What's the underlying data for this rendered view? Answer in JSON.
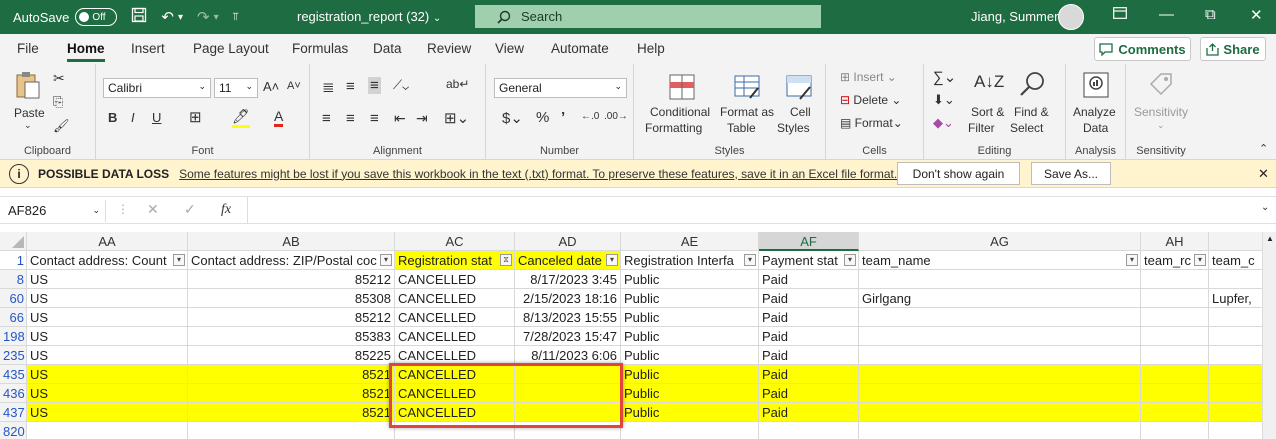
{
  "titlebar": {
    "autosave_label": "AutoSave",
    "autosave_state": "Off",
    "filename": "registration_report (32)",
    "search_placeholder": "Search",
    "user_name": "Jiang, Summer"
  },
  "ribbon_tabs": [
    "File",
    "Home",
    "Insert",
    "Page Layout",
    "Formulas",
    "Data",
    "Review",
    "View",
    "Automate",
    "Help"
  ],
  "active_tab": "Home",
  "header_buttons": {
    "comments": "Comments",
    "share": "Share"
  },
  "ribbon": {
    "clipboard": {
      "label": "Clipboard",
      "paste": "Paste"
    },
    "font": {
      "label": "Font",
      "font_name": "Calibri",
      "font_size": "11"
    },
    "alignment": {
      "label": "Alignment"
    },
    "number": {
      "label": "Number",
      "format": "General"
    },
    "styles": {
      "label": "Styles",
      "cond1": "Conditional",
      "cond2": "Formatting",
      "fmt1": "Format as",
      "fmt2": "Table",
      "cell1": "Cell",
      "cell2": "Styles"
    },
    "cells": {
      "label": "Cells",
      "insert": "Insert",
      "delete": "Delete",
      "format": "Format"
    },
    "editing": {
      "label": "Editing",
      "sort1": "Sort &",
      "sort2": "Filter",
      "find1": "Find &",
      "find2": "Select"
    },
    "analysis": {
      "label": "Analysis",
      "analyze1": "Analyze",
      "analyze2": "Data"
    },
    "sensitivity": {
      "label": "Sensitivity",
      "button": "Sensitivity"
    }
  },
  "message_bar": {
    "title": "POSSIBLE DATA LOSS",
    "text": "Some features might be lost if you save this workbook in the text (.txt) format. To preserve these features, save it in an Excel file format.",
    "btn_dont_show": "Don't show again",
    "btn_save_as": "Save As..."
  },
  "formula_bar": {
    "name_box": "AF826",
    "fx": "fx"
  },
  "column_headers": [
    "AA",
    "AB",
    "AC",
    "AD",
    "AE",
    "AF",
    "AG",
    "AH"
  ],
  "header_row": {
    "row_num": "1",
    "cells": [
      "Contact address: Count",
      "Contact address: ZIP/Postal coc",
      "Registration stat",
      "Canceled date",
      "Registration Interfa",
      "Payment stat",
      "team_name",
      "team_rc",
      "team_c"
    ]
  },
  "rows": [
    {
      "num": "8",
      "cells": [
        "US",
        "85212",
        "CANCELLED",
        "8/17/2023 3:45",
        "Public",
        "Paid",
        "",
        "",
        ""
      ],
      "highlight": false
    },
    {
      "num": "60",
      "cells": [
        "US",
        "85308",
        "CANCELLED",
        "2/15/2023 18:16",
        "Public",
        "Paid",
        "Girlgang",
        "",
        "Lupfer,"
      ],
      "highlight": false
    },
    {
      "num": "66",
      "cells": [
        "US",
        "85212",
        "CANCELLED",
        "8/13/2023 15:55",
        "Public",
        "Paid",
        "",
        "",
        ""
      ],
      "highlight": false
    },
    {
      "num": "198",
      "cells": [
        "US",
        "85383",
        "CANCELLED",
        "7/28/2023 15:47",
        "Public",
        "Paid",
        "",
        "",
        ""
      ],
      "highlight": false
    },
    {
      "num": "235",
      "cells": [
        "US",
        "85225",
        "CANCELLED",
        "8/11/2023 6:06",
        "Public",
        "Paid",
        "",
        "",
        ""
      ],
      "highlight": false
    },
    {
      "num": "435",
      "cells": [
        "US",
        "8521",
        "CANCELLED",
        "",
        "Public",
        "Paid",
        "",
        "",
        ""
      ],
      "highlight": true
    },
    {
      "num": "436",
      "cells": [
        "US",
        "8521",
        "CANCELLED",
        "",
        "Public",
        "Paid",
        "",
        "",
        ""
      ],
      "highlight": true
    },
    {
      "num": "437",
      "cells": [
        "US",
        "8521",
        "CANCELLED",
        "",
        "Public",
        "Paid",
        "",
        "",
        ""
      ],
      "highlight": true
    },
    {
      "num": "820",
      "cells": [
        "",
        "",
        "",
        "",
        "",
        "",
        "",
        "",
        ""
      ],
      "highlight": false
    }
  ],
  "colors": {
    "excel_green": "#1e6c41",
    "highlight_yellow": "#ffff00",
    "annotation_red": "#e2453b",
    "message_bar_bg": "#fff4ce"
  }
}
